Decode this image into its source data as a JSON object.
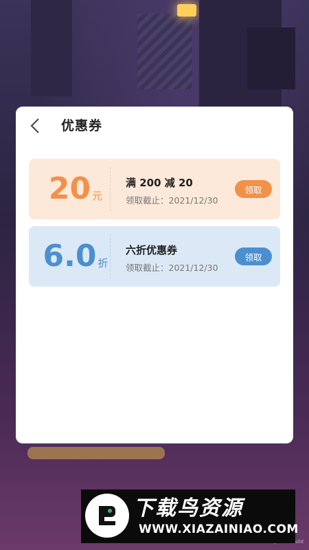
{
  "dialog": {
    "title": "优惠券",
    "back_icon": "chevron-left-icon"
  },
  "coupons": [
    {
      "amount": "20",
      "unit": "元",
      "description": "满 200 减 20",
      "expiry": "领取截止：2021/12/30",
      "button_label": "领取",
      "accent_color": "#f2914a",
      "background_color": "#fde9da"
    },
    {
      "amount": "6.0",
      "unit": "折",
      "description": "六折优惠券",
      "expiry": "领取截止：2021/12/30",
      "button_label": "领取",
      "accent_color": "#4c8fcf",
      "background_color": "#dbe9f7"
    }
  ],
  "background": {
    "build_label": "Development Build"
  },
  "watermark": {
    "title": "下载鸟资源",
    "url": "WWW.XIAZAINIAO.COM"
  }
}
